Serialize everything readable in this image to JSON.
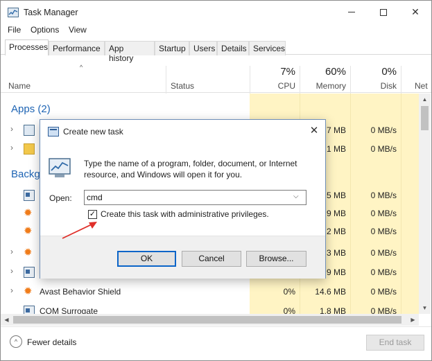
{
  "window": {
    "title": "Task Manager",
    "icon": "task-manager-icon",
    "controls": [
      "minimize-icon",
      "maximize-icon",
      "close-icon"
    ]
  },
  "menu": [
    "File",
    "Options",
    "View"
  ],
  "tabs": [
    "Processes",
    "Performance",
    "App history",
    "Startup",
    "Users",
    "Details",
    "Services"
  ],
  "active_tab": "Processes",
  "columns": {
    "name": "Name",
    "status": "Status",
    "cpu": {
      "percent": "7%",
      "label": "CPU"
    },
    "memory": {
      "percent": "60%",
      "label": "Memory"
    },
    "disk": {
      "percent": "0%",
      "label": "Disk"
    },
    "network": {
      "label": "Net"
    }
  },
  "groups": {
    "apps": "Apps (2)",
    "background": "Backg"
  },
  "rows": [
    {
      "name": "",
      "status": "",
      "cpu": "",
      "memory": "7 MB",
      "disk": "0 MB/s",
      "icon": "task-manager-icon"
    },
    {
      "name": "",
      "status": "",
      "cpu": "",
      "memory": "1 MB",
      "disk": "0 MB/s",
      "icon": "explorer-folder-icon"
    },
    {
      "name": "",
      "status": "",
      "cpu": "",
      "memory": "5 MB",
      "disk": "0 MB/s",
      "icon": "service-window-icon"
    },
    {
      "name": "",
      "status": "",
      "cpu": "",
      "memory": "9 MB",
      "disk": "0 MB/s",
      "icon": "avast-icon"
    },
    {
      "name": "",
      "status": "",
      "cpu": "",
      "memory": "2 MB",
      "disk": "0 MB/s",
      "icon": "avast-icon"
    },
    {
      "name": "",
      "status": "",
      "cpu": "",
      "memory": "3 MB",
      "disk": "0 MB/s",
      "icon": "avast-icon"
    },
    {
      "name": "",
      "status": "",
      "cpu": "",
      "memory": "9 MB",
      "disk": "0 MB/s",
      "icon": "service-window-icon"
    },
    {
      "name": "Avast Behavior Shield",
      "status": "",
      "cpu": "0%",
      "memory": "14.6 MB",
      "disk": "0 MB/s",
      "icon": "avast-icon"
    },
    {
      "name": "COM Surrogate",
      "status": "",
      "cpu": "0%",
      "memory": "1.8 MB",
      "disk": "0 MB/s",
      "icon": "service-window-icon"
    }
  ],
  "footer": {
    "fewer_details": "Fewer details",
    "end_task": "End task"
  },
  "dialog": {
    "title": "Create new task",
    "description": "Type the name of a program, folder, document, or Internet resource, and Windows will open it for you.",
    "open_label": "Open:",
    "open_value": "cmd",
    "admin_checkbox_label": "Create this task with administrative privileges.",
    "admin_checked": true,
    "buttons": {
      "ok": "OK",
      "cancel": "Cancel",
      "browse": "Browse..."
    }
  },
  "colors": {
    "accent_blue": "#1e64b4",
    "resource_highlight": "#fff4c4",
    "annotation_red": "#e0302a",
    "primary_button_border": "#0a64c8"
  }
}
